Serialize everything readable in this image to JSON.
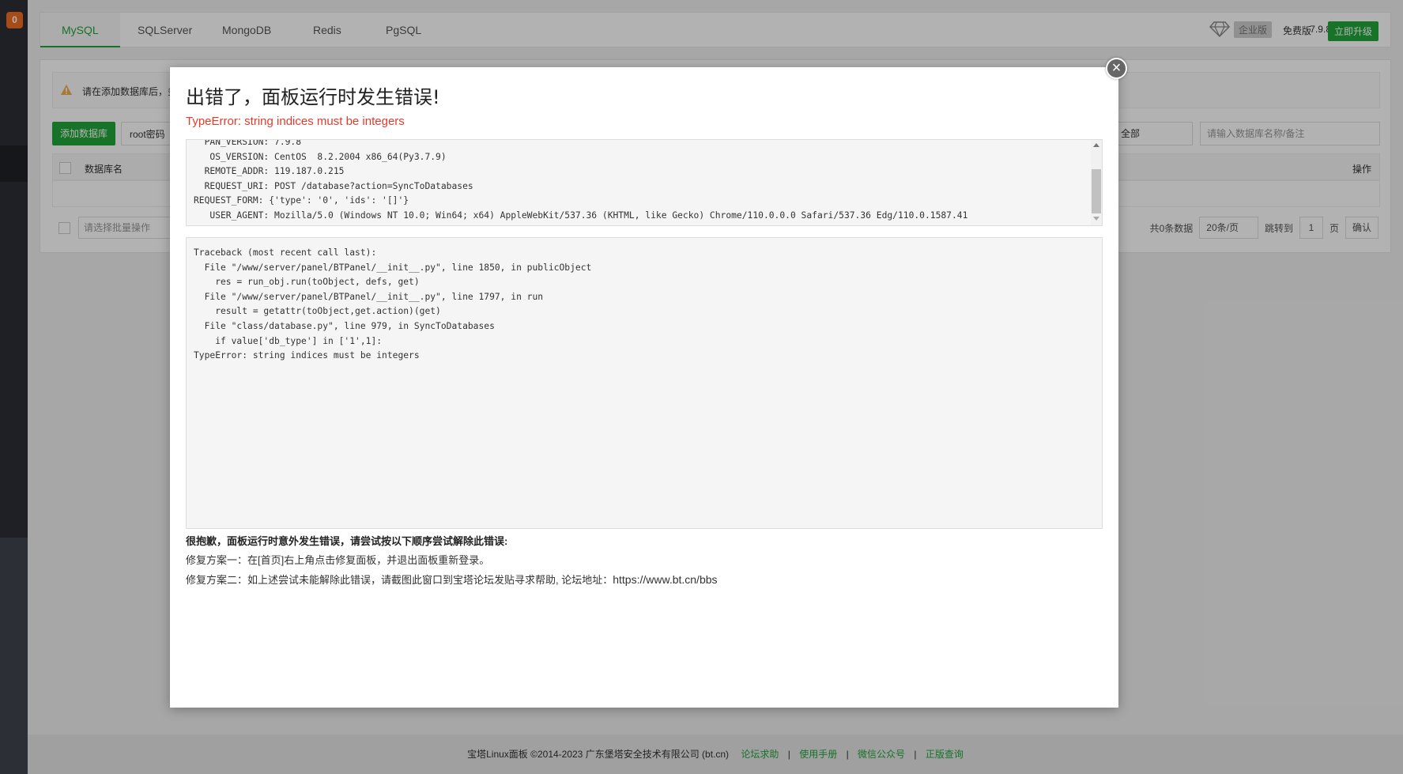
{
  "sidebar": {
    "badge": "0"
  },
  "tabs": [
    "MySQL",
    "SQLServer",
    "MongoDB",
    "Redis",
    "PgSQL"
  ],
  "header": {
    "enterprise_label": "企业版",
    "free_label": "免费版",
    "version": "7.9.8",
    "upgrade_label": "立即升级"
  },
  "panel": {
    "notice": "请在添加数据库后，务",
    "add_db_label": "添加数据库",
    "root_pw_label": "root密码",
    "filter_value": "全部",
    "search_placeholder": "请输入数据库名称/备注",
    "col_name": "数据库名",
    "col_op": "操作",
    "batch_placeholder": "请选择批量操作",
    "total": "共0条数据",
    "per_page": "20条/页",
    "jump_label": "跳转到",
    "page_num": "1",
    "page_unit": "页",
    "confirm_label": "确认"
  },
  "modal": {
    "title": "出错了，面板运行时发生错误!",
    "subtitle": "TypeError: string indices must be integers",
    "env_lines": [
      "  PAN_VERSION: 7.9.8",
      "   OS_VERSION: CentOS  8.2.2004 x86_64(Py3.7.9)",
      "  REMOTE_ADDR: 119.187.0.215",
      "  REQUEST_URI: POST /database?action=SyncToDatabases",
      "REQUEST_FORM: {'type': '0', 'ids': '[]'}",
      "   USER_AGENT: Mozilla/5.0 (Windows NT 10.0; Win64; x64) AppleWebKit/537.36 (KHTML, like Gecko) Chrome/110.0.0.0 Safari/537.36 Edg/110.0.1587.41"
    ],
    "traceback": [
      "Traceback (most recent call last):",
      "  File \"/www/server/panel/BTPanel/__init__.py\", line 1850, in publicObject",
      "    res = run_obj.run(toObject, defs, get)",
      "  File \"/www/server/panel/BTPanel/__init__.py\", line 1797, in run",
      "    result = getattr(toObject,get.action)(get)",
      "  File \"class/database.py\", line 979, in SyncToDatabases",
      "    if value['db_type'] in ['1',1]:",
      "TypeError: string indices must be integers"
    ],
    "help_heading": "很抱歉，面板运行时意外发生错误，请尝试按以下顺序尝试解除此错误:",
    "fix1": "修复方案一：在[首页]右上角点击修复面板，并退出面板重新登录。",
    "fix2": "修复方案二：如上述尝试未能解除此错误，请截图此窗口到宝塔论坛发贴寻求帮助, 论坛地址：",
    "forum_url": "https://www.bt.cn/bbs"
  },
  "footer": {
    "copyright": "宝塔Linux面板 ©2014-2023 广东堡塔安全技术有限公司 (bt.cn)",
    "links": [
      "论坛求助",
      "使用手册",
      "微信公众号",
      "正版查询"
    ]
  },
  "colors": {
    "accent": "#20a53a",
    "error": "#e03c2d",
    "badge": "#f06d22"
  }
}
